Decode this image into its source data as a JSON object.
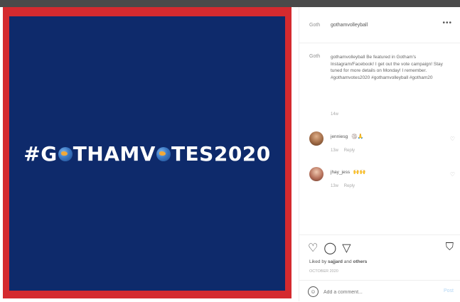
{
  "post": {
    "hashtag_parts": [
      "#G",
      "THAMV",
      "TES2020"
    ]
  },
  "header": {
    "logo": "Goth",
    "username": "gothamvolleyball",
    "more": "•••"
  },
  "caption": {
    "logo": "Goth",
    "text": "gothamvolleyball Be featured in Gotham's Instagram/Facebook! I get out the vote campaign! Stay tuned for more details on Monday! I remember. #gothamvotes2020 #gothamvolleyball #gotham20",
    "time": "14w"
  },
  "comments": [
    {
      "user": "jenniesg",
      "emoji": "🏐🙏",
      "time": "13w",
      "reply": "Reply"
    },
    {
      "user": "jhay_jess",
      "emoji": "🙌🙌",
      "time": "13w",
      "reply": "Reply"
    }
  ],
  "actions": {
    "liked_prefix": "Liked by ",
    "liked_user": "sajjard",
    "liked_suffix": " and ",
    "liked_others": "others",
    "date": "OCTOBER 2020"
  },
  "add_comment": {
    "placeholder": "Add a comment...",
    "post": "Post"
  }
}
